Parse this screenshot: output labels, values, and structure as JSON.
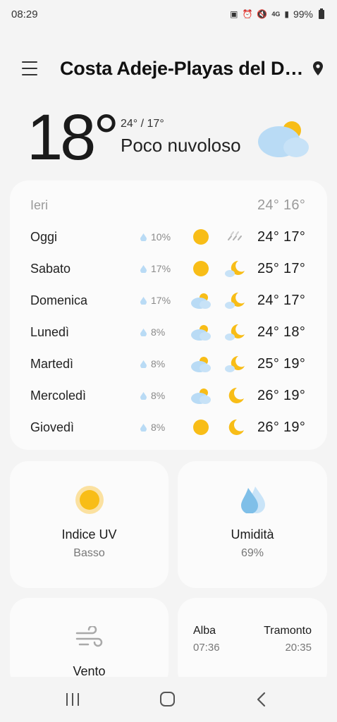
{
  "status_bar": {
    "time": "08:29",
    "network": "4G",
    "battery": "99%"
  },
  "header": {
    "location": "Costa Adeje-Playas del Du...",
    "menu_icon": "menu-icon",
    "pin_icon": "location-pin-icon"
  },
  "current": {
    "temperature": "18°",
    "hi_lo": "24° / 17°",
    "condition": "Poco nuvoloso",
    "icon": "partly-cloudy-icon"
  },
  "forecast": {
    "yesterday": {
      "day": "Ieri",
      "temps": "24° 16°"
    },
    "days": [
      {
        "day": "Oggi",
        "precip": "10%",
        "day_icon": "sun-icon",
        "night_icon": "drizzle-icon",
        "temps": "24° 17°"
      },
      {
        "day": "Sabato",
        "precip": "17%",
        "day_icon": "sun-icon",
        "night_icon": "moon-cloud-icon",
        "temps": "25° 17°"
      },
      {
        "day": "Domenica",
        "precip": "17%",
        "day_icon": "sun-cloud-icon",
        "night_icon": "moon-cloud-icon",
        "temps": "24° 17°"
      },
      {
        "day": "Lunedì",
        "precip": "8%",
        "day_icon": "sun-cloud-icon",
        "night_icon": "moon-cloud-icon",
        "temps": "24° 18°"
      },
      {
        "day": "Martedì",
        "precip": "8%",
        "day_icon": "sun-cloud-icon",
        "night_icon": "moon-cloud-icon",
        "temps": "25° 19°"
      },
      {
        "day": "Mercoledì",
        "precip": "8%",
        "day_icon": "sun-cloud-icon",
        "night_icon": "moon-icon",
        "temps": "26° 19°"
      },
      {
        "day": "Giovedì",
        "precip": "8%",
        "day_icon": "sun-icon",
        "night_icon": "moon-icon",
        "temps": "26° 19°"
      }
    ]
  },
  "uv": {
    "title": "Indice UV",
    "value": "Basso",
    "icon": "sun-icon"
  },
  "humidity": {
    "title": "Umidità",
    "value": "69%",
    "icon": "water-drops-icon"
  },
  "wind": {
    "title": "Vento",
    "icon": "wind-icon"
  },
  "sun": {
    "sunrise_label": "Alba",
    "sunrise_time": "07:36",
    "sunset_label": "Tramonto",
    "sunset_time": "20:35"
  },
  "colors": {
    "background": "#f4f4f4",
    "card": "#fbfbfb",
    "sun": "#f8bd17",
    "cloud": "#b9dbf5",
    "drop": "#7fbfe8"
  }
}
